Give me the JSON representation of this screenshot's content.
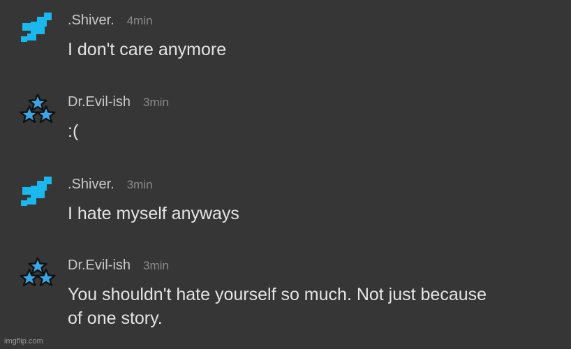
{
  "messages": [
    {
      "username": ".Shiver.",
      "time": "4min",
      "text": "I don't care anymore",
      "avatar": "blue-pixel-arrow-icon",
      "avatar_color": "#1ab8ec"
    },
    {
      "username": "Dr.Evil-ish",
      "time": "3min",
      "text": ":(",
      "avatar": "three-stars-icon",
      "avatar_color": "#3aa6e6"
    },
    {
      "username": ".Shiver.",
      "time": "3min",
      "text": "I hate myself anyways",
      "avatar": "blue-pixel-arrow-icon",
      "avatar_color": "#1ab8ec"
    },
    {
      "username": "Dr.Evil-ish",
      "time": "3min",
      "text": "You shouldn't hate yourself so much. Not just because of one story.",
      "avatar": "three-stars-icon",
      "avatar_color": "#3aa6e6"
    }
  ],
  "watermark": "imgflip.com",
  "colors": {
    "background": "#363636",
    "username": "#c9c9c9",
    "timestamp": "#8a8a8a",
    "message_text": "#e4e4e4"
  }
}
